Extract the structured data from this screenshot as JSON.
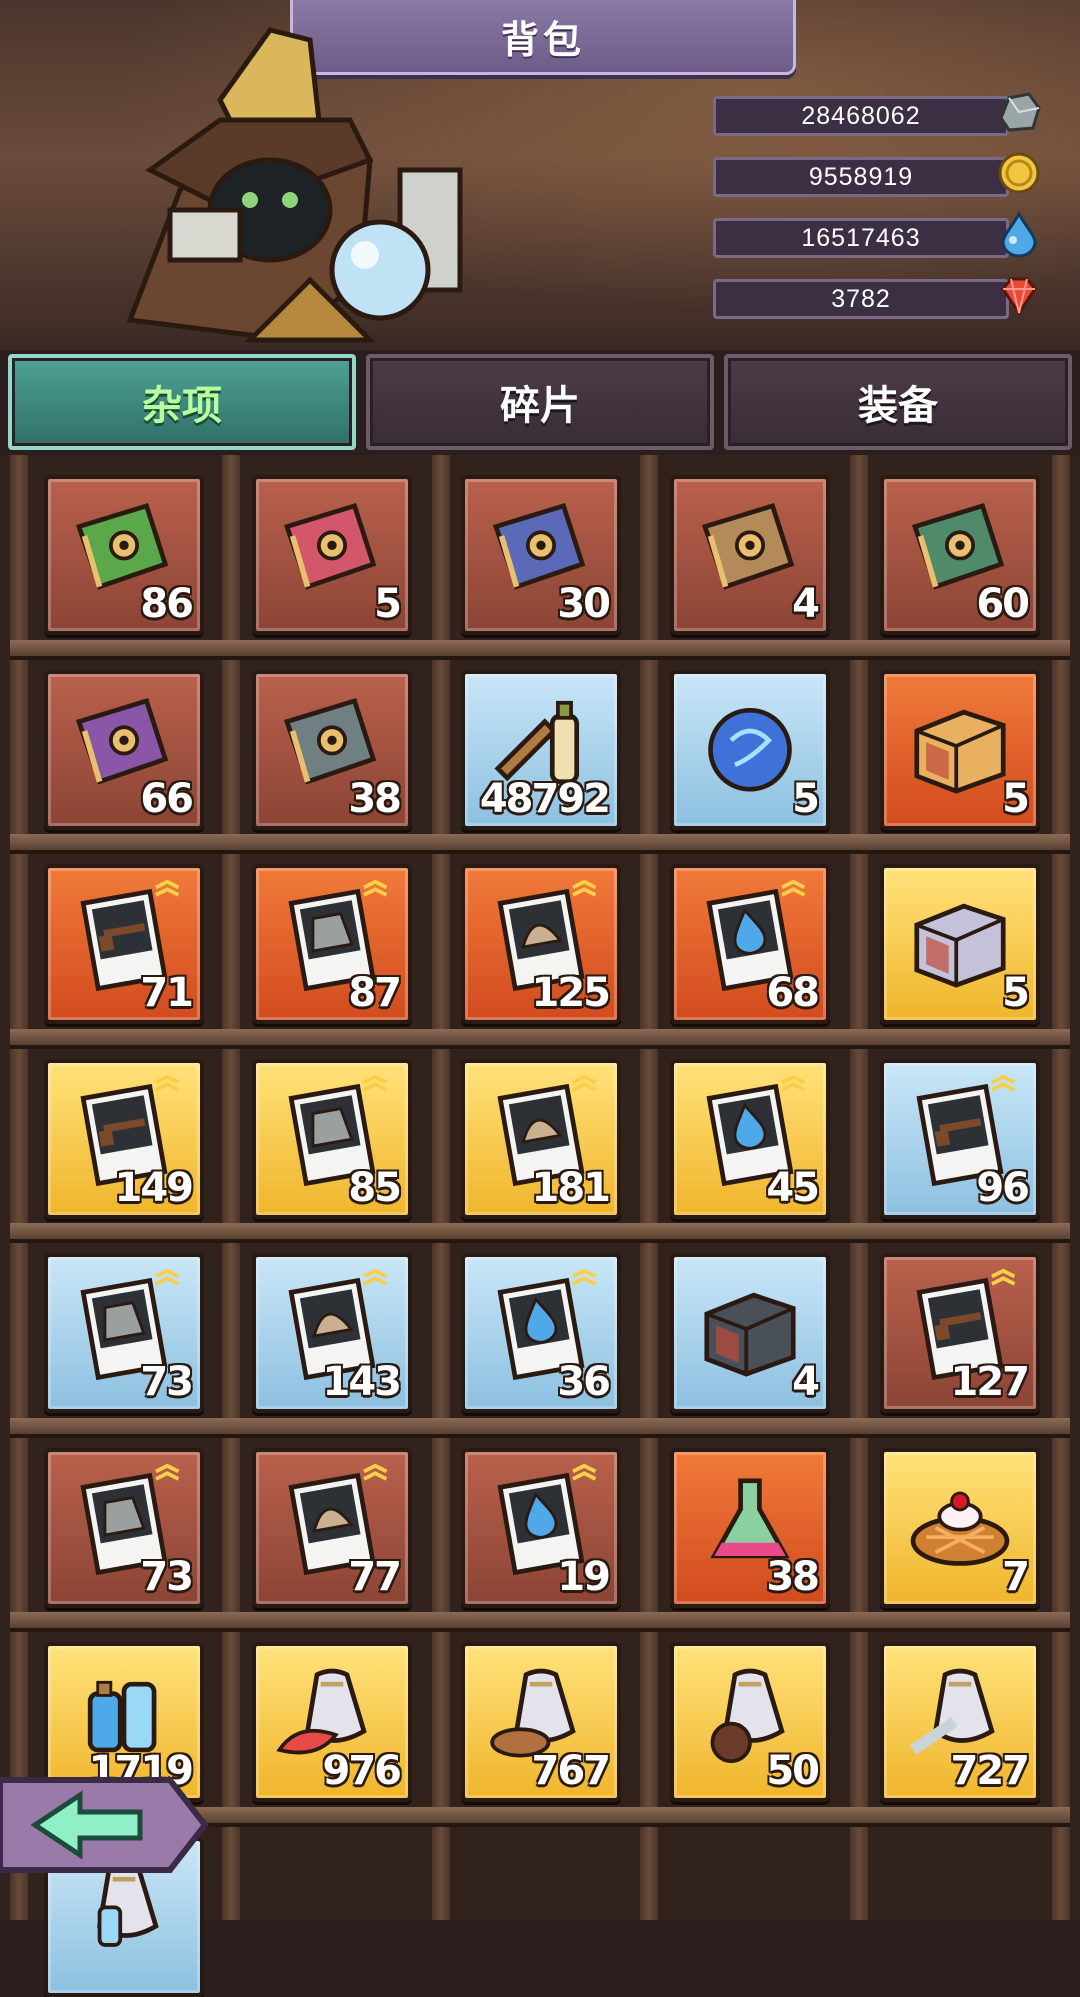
{
  "title": "背包",
  "currencies": [
    {
      "value": "28468062",
      "icon": "ore-icon"
    },
    {
      "value": "9558919",
      "icon": "gold-coin-icon"
    },
    {
      "value": "16517463",
      "icon": "water-drop-icon"
    },
    {
      "value": "3782",
      "icon": "red-gem-icon"
    }
  ],
  "tabs": [
    {
      "label": "杂项",
      "active": true
    },
    {
      "label": "碎片",
      "active": false
    },
    {
      "label": "装备",
      "active": false
    }
  ],
  "items": [
    {
      "icon": "green-book-icon",
      "count": "86",
      "frame": "brown"
    },
    {
      "icon": "red-skill-book-icon",
      "count": "5",
      "frame": "brown"
    },
    {
      "icon": "blue-skill-book-icon",
      "count": "30",
      "frame": "brown"
    },
    {
      "icon": "tan-skill-book-icon",
      "count": "4",
      "frame": "brown"
    },
    {
      "icon": "green-skill-book-icon",
      "count": "60",
      "frame": "brown"
    },
    {
      "icon": "purple-skill-book-icon",
      "count": "66",
      "frame": "brown"
    },
    {
      "icon": "gray-skill-book-icon",
      "count": "38",
      "frame": "brown"
    },
    {
      "icon": "brush-bottle-icon",
      "count": "48792",
      "frame": "blue"
    },
    {
      "icon": "blue-orb-icon",
      "count": "5",
      "frame": "blue"
    },
    {
      "icon": "orange-chest-icon",
      "count": "5",
      "frame": "orange"
    },
    {
      "icon": "gun-card-icon",
      "count": "71",
      "frame": "orange"
    },
    {
      "icon": "armor-card-icon",
      "count": "87",
      "frame": "orange"
    },
    {
      "icon": "helmet-card-icon",
      "count": "125",
      "frame": "orange"
    },
    {
      "icon": "drop-card-icon",
      "count": "68",
      "frame": "orange"
    },
    {
      "icon": "silver-chest-icon",
      "count": "5",
      "frame": "gold"
    },
    {
      "icon": "gun-card-icon",
      "count": "149",
      "frame": "gold"
    },
    {
      "icon": "armor-card-icon",
      "count": "85",
      "frame": "gold"
    },
    {
      "icon": "helmet-card-icon",
      "count": "181",
      "frame": "gold"
    },
    {
      "icon": "drop-card-icon",
      "count": "45",
      "frame": "gold"
    },
    {
      "icon": "gun-card-icon",
      "count": "96",
      "frame": "blue"
    },
    {
      "icon": "armor-card-icon",
      "count": "73",
      "frame": "blue"
    },
    {
      "icon": "helmet-card-icon",
      "count": "143",
      "frame": "blue"
    },
    {
      "icon": "drop-card-icon",
      "count": "36",
      "frame": "blue"
    },
    {
      "icon": "dark-chest-icon",
      "count": "4",
      "frame": "blue"
    },
    {
      "icon": "gun-card-icon",
      "count": "127",
      "frame": "brown"
    },
    {
      "icon": "armor-card-icon",
      "count": "73",
      "frame": "brown"
    },
    {
      "icon": "helmet-card-icon",
      "count": "77",
      "frame": "brown"
    },
    {
      "icon": "drop-card-icon",
      "count": "19",
      "frame": "brown"
    },
    {
      "icon": "potion-flask-icon",
      "count": "38",
      "frame": "orange"
    },
    {
      "icon": "cherry-pie-icon",
      "count": "7",
      "frame": "gold"
    },
    {
      "icon": "potion-bottles-icon",
      "count": "1719",
      "frame": "gold"
    },
    {
      "icon": "meat-pack-icon",
      "count": "976",
      "frame": "gold"
    },
    {
      "icon": "fish-pack-icon",
      "count": "767",
      "frame": "gold"
    },
    {
      "icon": "paw-pack-icon",
      "count": "50",
      "frame": "gold"
    },
    {
      "icon": "wrench-pack-icon",
      "count": "727",
      "frame": "gold"
    },
    {
      "icon": "bottle-pack-icon",
      "count": "",
      "frame": "blue"
    }
  ]
}
